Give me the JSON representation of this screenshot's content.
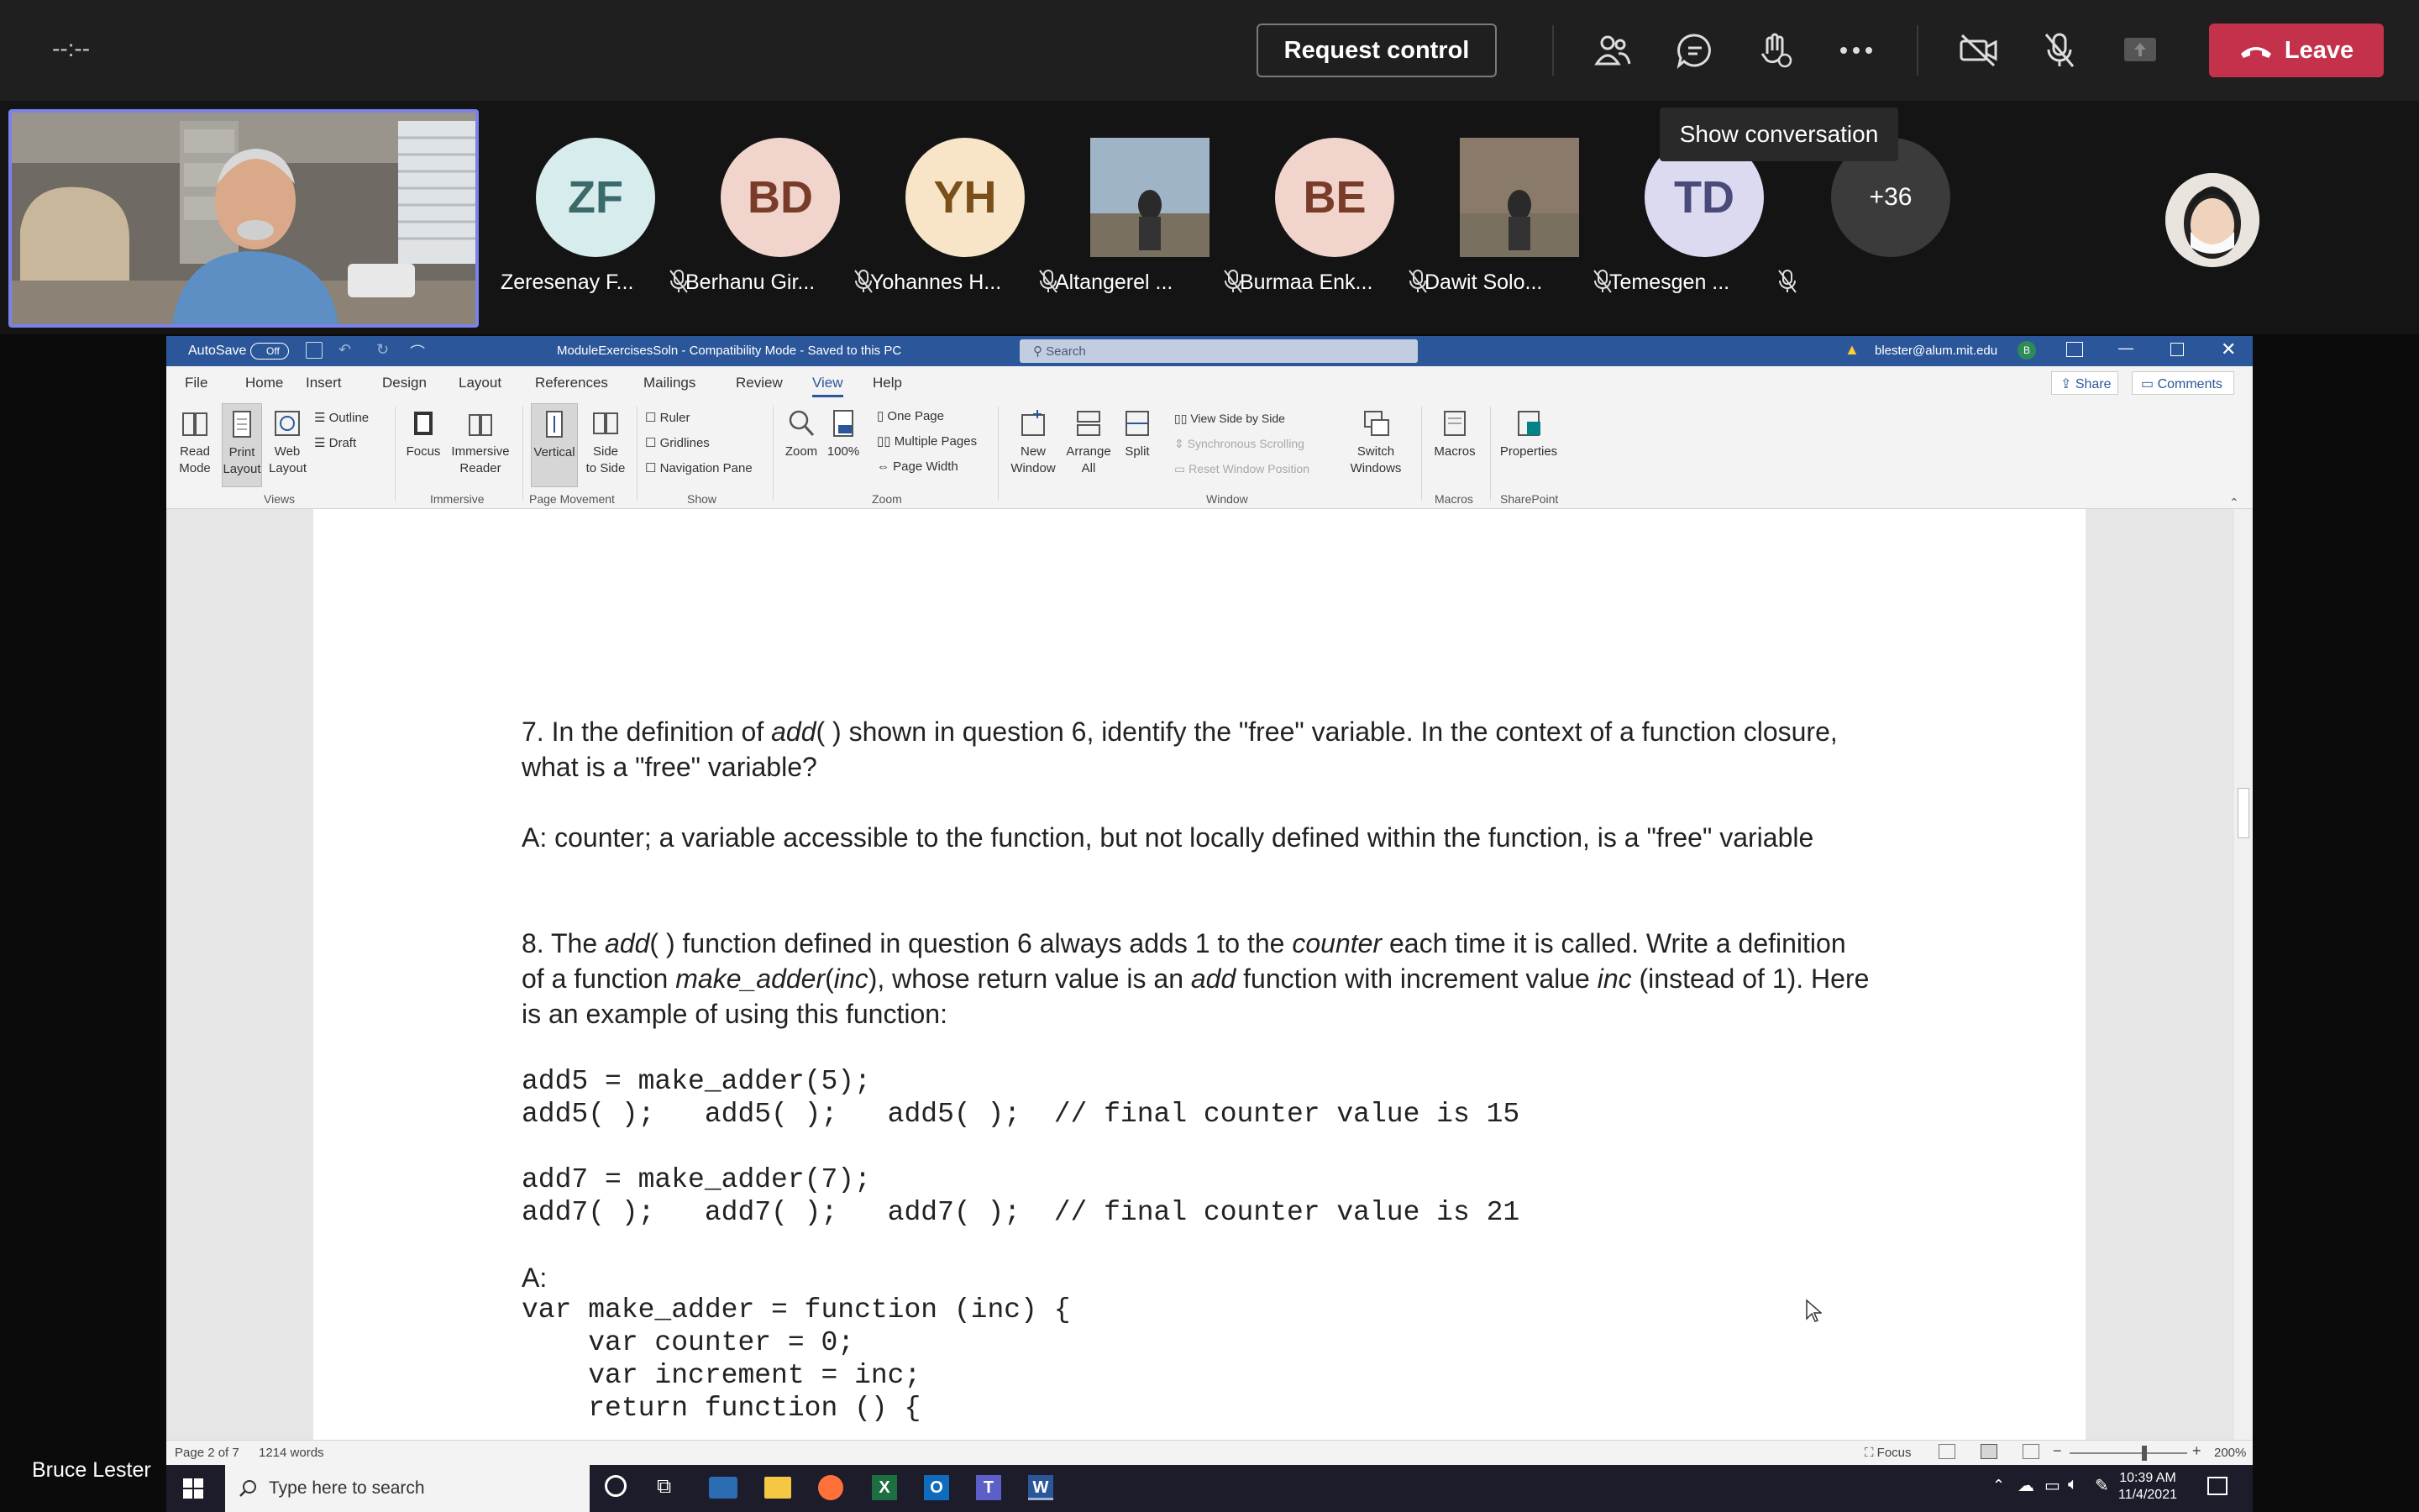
{
  "meeting": {
    "timer": "--:--",
    "request_control": "Request control",
    "leave": "Leave",
    "tooltip": "Show conversation",
    "presenter": "Bruce Lester",
    "more_count": "+36",
    "participants": [
      {
        "initials": "ZF",
        "name": "Zeresenay F...",
        "bg": "#d7ecec",
        "fg": "#3a6a6a"
      },
      {
        "initials": "BD",
        "name": "Berhanu Gir...",
        "bg": "#f1d5cc",
        "fg": "#7a3c2a"
      },
      {
        "initials": "YH",
        "name": "Yohannes H...",
        "bg": "#f8e5c8",
        "fg": "#7a4f1a"
      },
      {
        "initials": "",
        "name": "Altangerel ...",
        "bg": "#9fb4c7",
        "fg": "#333"
      },
      {
        "initials": "BE",
        "name": "Burmaa Enk...",
        "bg": "#f1d5cc",
        "fg": "#7a3c2a"
      },
      {
        "initials": "",
        "name": "Dawit Solo...",
        "bg": "#8a7a6a",
        "fg": "#333"
      },
      {
        "initials": "TD",
        "name": "Temesgen ...",
        "bg": "#dcdaf0",
        "fg": "#4a4a7a"
      }
    ]
  },
  "word": {
    "autosave": "AutoSave",
    "autosave_state": "Off",
    "doc_title": "ModuleExercisesSoln  -  Compatibility Mode  -  Saved to this PC",
    "search": "Search",
    "account": "blester@alum.mit.edu",
    "account_initial": "B",
    "menu": [
      "File",
      "Home",
      "Insert",
      "Design",
      "Layout",
      "References",
      "Mailings",
      "Review",
      "View",
      "Help"
    ],
    "active_menu": "View",
    "share": "Share",
    "comments": "Comments",
    "ribbon": {
      "read_mode": "Read\nMode",
      "print_layout": "Print\nLayout",
      "web_layout": "Web\nLayout",
      "outline": "Outline",
      "draft": "Draft",
      "focus": "Focus",
      "immersive_reader": "Immersive\nReader",
      "vertical": "Vertical",
      "side_to_side": "Side\nto Side",
      "ruler": "Ruler",
      "gridlines": "Gridlines",
      "navigation_pane": "Navigation Pane",
      "zoom": "Zoom",
      "hundred": "100%",
      "one_page": "One Page",
      "multiple_pages": "Multiple Pages",
      "page_width": "Page Width",
      "new_window": "New\nWindow",
      "arrange_all": "Arrange\nAll",
      "split": "Split",
      "view_side_by_side": "View Side by Side",
      "sync_scrolling": "Synchronous Scrolling",
      "reset_window": "Reset Window Position",
      "switch_windows": "Switch\nWindows",
      "macros": "Macros",
      "properties": "Properties",
      "groups": [
        "Views",
        "Immersive",
        "Page Movement",
        "Show",
        "Zoom",
        "Window",
        "Macros",
        "SharePoint"
      ]
    },
    "doc": {
      "q7_line1": "7.  In the definition of add( ) shown in question 6, identify the \"free\" variable. In the context of a function closure,",
      "q7_line2": "what is a \"free\" variable?",
      "a7": "A:  counter;   a variable accessible to the function, but not locally defined within the function, is a \"free\" variable",
      "q8_line1": "8.  The add( ) function defined in question 6 always adds 1 to the counter each time it is  called. Write a definition",
      "q8_line2": "of a function make_adder(inc), whose return value is an add function with increment value inc (instead of 1). Here",
      "q8_line3": "is an example of using this function:",
      "code1": "add5 = make_adder(5);",
      "code2": "add5( );   add5( );   add5( );  // final counter value is 15",
      "code3": "add7 = make_adder(7);",
      "code4": "add7( );   add7( );   add7( );  // final counter value is 21",
      "a8": "A:",
      "code5": "var make_adder = function (inc) {",
      "code6": "    var counter = 0;",
      "code7": "    var increment = inc;",
      "code8": "    return function () {"
    },
    "status": {
      "page": "Page 2 of 7",
      "words": "1214 words",
      "focus": "Focus",
      "zoom": "200%"
    }
  },
  "taskbar": {
    "search_placeholder": "Type here to search",
    "time": "10:39 AM",
    "date": "11/4/2021"
  }
}
